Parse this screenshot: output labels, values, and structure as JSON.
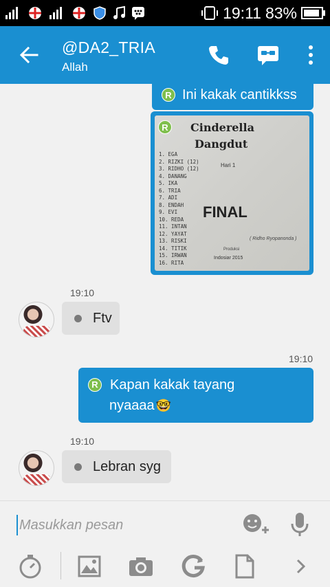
{
  "status": {
    "time": "19:11",
    "battery": "83%"
  },
  "header": {
    "title": "@DA2_TRIA",
    "subtitle": "Allah"
  },
  "messages": {
    "m1": {
      "text": "Ini kakak cantikkss",
      "badge": "R"
    },
    "m2": {
      "badge": "R",
      "photo": {
        "title_line1": "Cinderella",
        "title_line2": "Dangdut",
        "hari": "Hari 1",
        "final": "FINAL",
        "list": [
          "1. EGA",
          "2. RIZKI (12)",
          "3. RIDHO (12)",
          "4. DANANG",
          "5. IKA",
          "6. TRIA",
          "7. ADI",
          "8. ENDAH",
          "9. EVI",
          "10. REDA",
          "11. INTAN",
          "12. YAYAT",
          "13. RISKI",
          "14. TITIK",
          "15. IRWAN",
          "16. RITA"
        ],
        "sign": "( Ridho Ryopanonda )",
        "producer": "Produksi",
        "network": "Indosiar 2015"
      }
    },
    "m3": {
      "time": "19:10",
      "text": "Ftv"
    },
    "m4": {
      "time": "19:10",
      "badge": "R",
      "line1": "Kapan kakak tayang",
      "line2": "nyaaaa",
      "emoji": "🤓"
    },
    "m5": {
      "time": "19:10",
      "text": "Lebran syg"
    }
  },
  "composer": {
    "placeholder": "Masukkan pesan"
  },
  "colors": {
    "accent": "#1a8fd1",
    "badge_green": "#7fbf4d",
    "incoming_bubble": "#e0e0e0",
    "background": "#f1f1f1"
  },
  "icons": [
    "back-arrow-icon",
    "phone-icon",
    "video-chat-icon",
    "more-vert-icon",
    "add-emoji-icon",
    "mic-icon",
    "timer-icon",
    "image-icon",
    "camera-icon",
    "refresh-g-icon",
    "document-icon",
    "chevron-right-icon"
  ]
}
